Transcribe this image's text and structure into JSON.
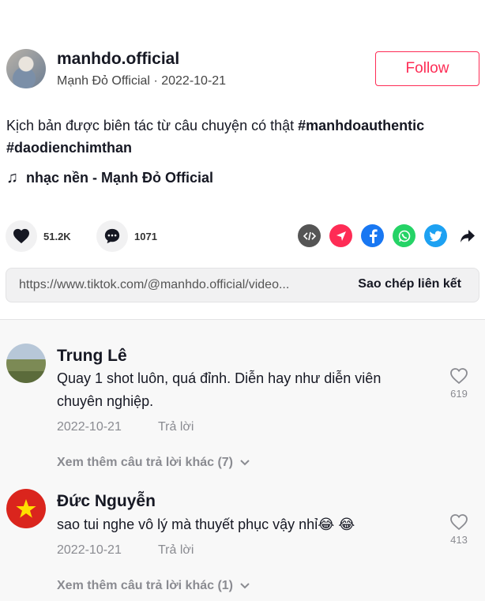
{
  "author": {
    "username": "manhdo.official",
    "display_name": "Mạnh Đỏ Official",
    "date": "2022-10-21",
    "follow_label": "Follow"
  },
  "post": {
    "caption": "Kịch bản được biên tác từ câu chuyện có thật",
    "hashtag1": "#manhdoauthentic",
    "hashtag2": "#daodienchimthan",
    "music": "nhạc nền - Mạnh Đỏ Official",
    "likes": "51.2K",
    "comments_count": "1071"
  },
  "share_icons": [
    "embed-icon",
    "send-icon",
    "facebook-icon",
    "whatsapp-icon",
    "twitter-icon",
    "share-arrow-icon"
  ],
  "link": {
    "url": "https://www.tiktok.com/@manhdo.official/video...",
    "copy_label": "Sao chép liên kết"
  },
  "comments": [
    {
      "name": "Trung Lê",
      "text": "Quay 1 shot luôn, quá đỉnh. Diễn hay như diễn viên chuyên nghiệp.",
      "date": "2022-10-21",
      "reply_label": "Trả lời",
      "likes": "619",
      "more_replies": "Xem thêm câu trả lời khác (7)"
    },
    {
      "name": "Đức Nguyễn",
      "text": "sao tui nghe vô lý mà thuyết phục vậy nhỉ😂 😂",
      "date": "2022-10-21",
      "reply_label": "Trả lời",
      "likes": "413",
      "more_replies": "Xem thêm câu trả lời khác (1)"
    }
  ],
  "colors": {
    "accent": "#fe2c55",
    "embed": "#555555",
    "send": "#fe2c55",
    "facebook": "#1877f2",
    "whatsapp": "#25d366",
    "twitter": "#1da1f2"
  }
}
